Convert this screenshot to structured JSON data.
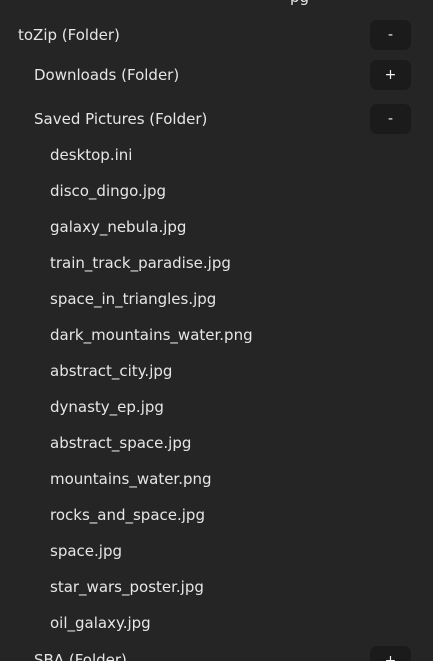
{
  "top_partial": {
    "label": "pg"
  },
  "root": {
    "label": "toZip (Folder)",
    "toggle": "-"
  },
  "downloads": {
    "label": "Downloads (Folder)",
    "toggle": "+"
  },
  "saved_pictures": {
    "label": "Saved Pictures (Folder)",
    "toggle": "-",
    "files": [
      "desktop.ini",
      "disco_dingo.jpg",
      "galaxy_nebula.jpg",
      "train_track_paradise.jpg",
      "space_in_triangles.jpg",
      "dark_mountains_water.png",
      "abstract_city.jpg",
      "dynasty_ep.jpg",
      "abstract_space.jpg",
      "mountains_water.png",
      "rocks_and_space.jpg",
      "space.jpg",
      "star_wars_poster.jpg",
      "oil_galaxy.jpg"
    ]
  },
  "sba": {
    "label": "SBA (Folder)",
    "toggle": "+"
  }
}
